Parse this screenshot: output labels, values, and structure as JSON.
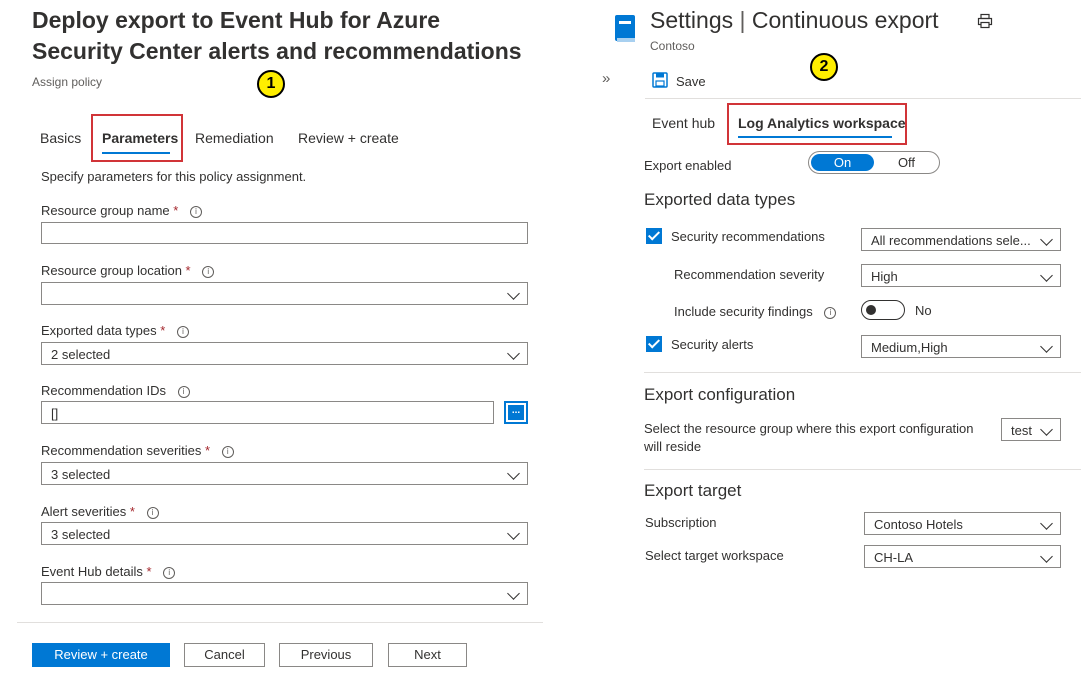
{
  "left": {
    "title_line1": "Deploy export to Event Hub for Azure",
    "title_line2": "Security Center alerts and recommendations",
    "subtitle": "Assign policy",
    "badge": "1",
    "tabs": [
      "Basics",
      "Parameters",
      "Remediation",
      "Review + create"
    ],
    "intro": "Specify parameters for this policy assignment.",
    "fields": {
      "rg_name": {
        "label": "Resource group name",
        "value": ""
      },
      "rg_location": {
        "label": "Resource group location",
        "value": ""
      },
      "exported_types": {
        "label": "Exported data types",
        "value": "2 selected"
      },
      "rec_ids": {
        "label": "Recommendation IDs",
        "value": "[]",
        "browse": "..."
      },
      "rec_severities": {
        "label": "Recommendation severities",
        "value": "3 selected"
      },
      "alert_severities": {
        "label": "Alert severities",
        "value": "3 selected"
      },
      "eventhub_details": {
        "label": "Event Hub details",
        "value": ""
      }
    },
    "required_mark": "*",
    "buttons": {
      "review": "Review + create",
      "cancel": "Cancel",
      "previous": "Previous",
      "next": "Next"
    }
  },
  "right": {
    "collapse_icon": "»",
    "title_main": "Settings",
    "title_sep": "|",
    "title_sub": "Continuous export",
    "org": "Contoso",
    "badge": "2",
    "save_label": "Save",
    "tabs": [
      "Event hub",
      "Log Analytics workspace"
    ],
    "export_enabled": {
      "label": "Export enabled",
      "on": "On",
      "off": "Off",
      "state": "On"
    },
    "data_types": {
      "heading": "Exported data types",
      "security_recs": {
        "label": "Security recommendations",
        "value": "All recommendations sele...",
        "checked": true
      },
      "rec_severity": {
        "label": "Recommendation severity",
        "value": "High"
      },
      "include_findings": {
        "label": "Include security findings",
        "value": "No",
        "enabled": false
      },
      "security_alerts": {
        "label": "Security alerts",
        "value": "Medium,High",
        "checked": true
      }
    },
    "export_config": {
      "heading": "Export configuration",
      "text_line1": "Select the resource group where this export configuration",
      "text_line2": "will reside",
      "value": "test"
    },
    "export_target": {
      "heading": "Export target",
      "subscription": {
        "label": "Subscription",
        "value": "Contoso Hotels"
      },
      "workspace": {
        "label": "Select target workspace",
        "value": "CH-LA"
      }
    }
  },
  "colors": {
    "accent": "#0078d4",
    "highlight": "#d13438",
    "badge": "#ffee00"
  }
}
